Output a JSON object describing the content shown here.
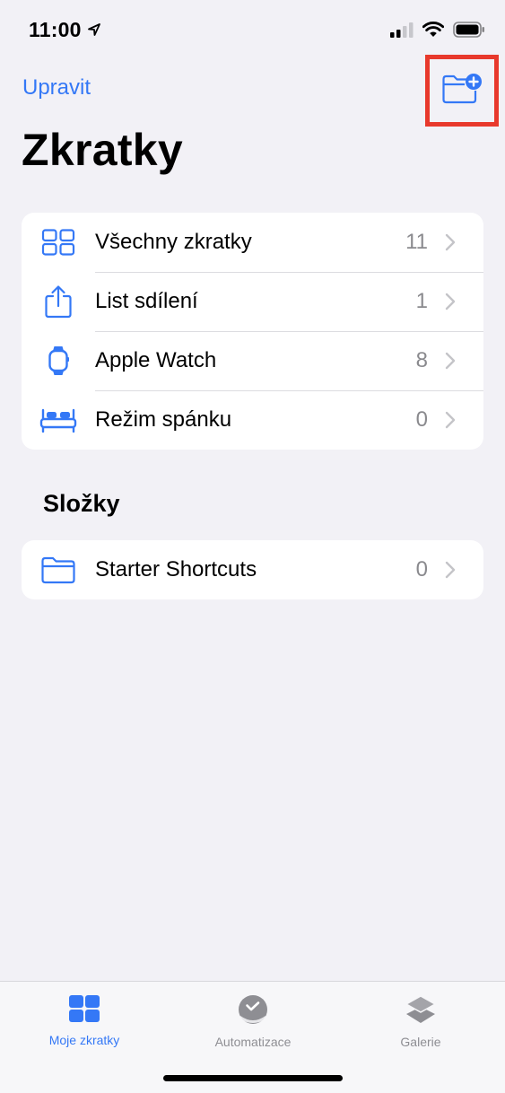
{
  "colors": {
    "accent": "#3478f6",
    "highlight": "#e8392c",
    "tab_inactive": "#8e8e93",
    "icon_gray": "#8e8e93"
  },
  "status_bar": {
    "time": "11:00",
    "location_icon": "location-arrow-icon",
    "cellular_icon": "cellular-signal-icon",
    "wifi_icon": "wifi-icon",
    "battery_icon": "battery-icon"
  },
  "nav": {
    "edit_label": "Upravit",
    "new_folder_icon": "folder-plus-icon"
  },
  "title": "Zkratky",
  "library": [
    {
      "icon": "grid-icon",
      "label": "Všechny zkratky",
      "count": "11"
    },
    {
      "icon": "share-icon",
      "label": "List sdílení",
      "count": "1"
    },
    {
      "icon": "watch-icon",
      "label": "Apple Watch",
      "count": "8"
    },
    {
      "icon": "bed-icon",
      "label": "Režim spánku",
      "count": "0"
    }
  ],
  "folders_section": {
    "title": "Složky",
    "items": [
      {
        "icon": "folder-icon",
        "label": "Starter Shortcuts",
        "count": "0"
      }
    ]
  },
  "tabbar": {
    "tabs": [
      {
        "icon": "my-shortcuts-icon",
        "label": "Moje zkratky",
        "active": true
      },
      {
        "icon": "automation-icon",
        "label": "Automatizace",
        "active": false
      },
      {
        "icon": "gallery-icon",
        "label": "Galerie",
        "active": false
      }
    ]
  }
}
